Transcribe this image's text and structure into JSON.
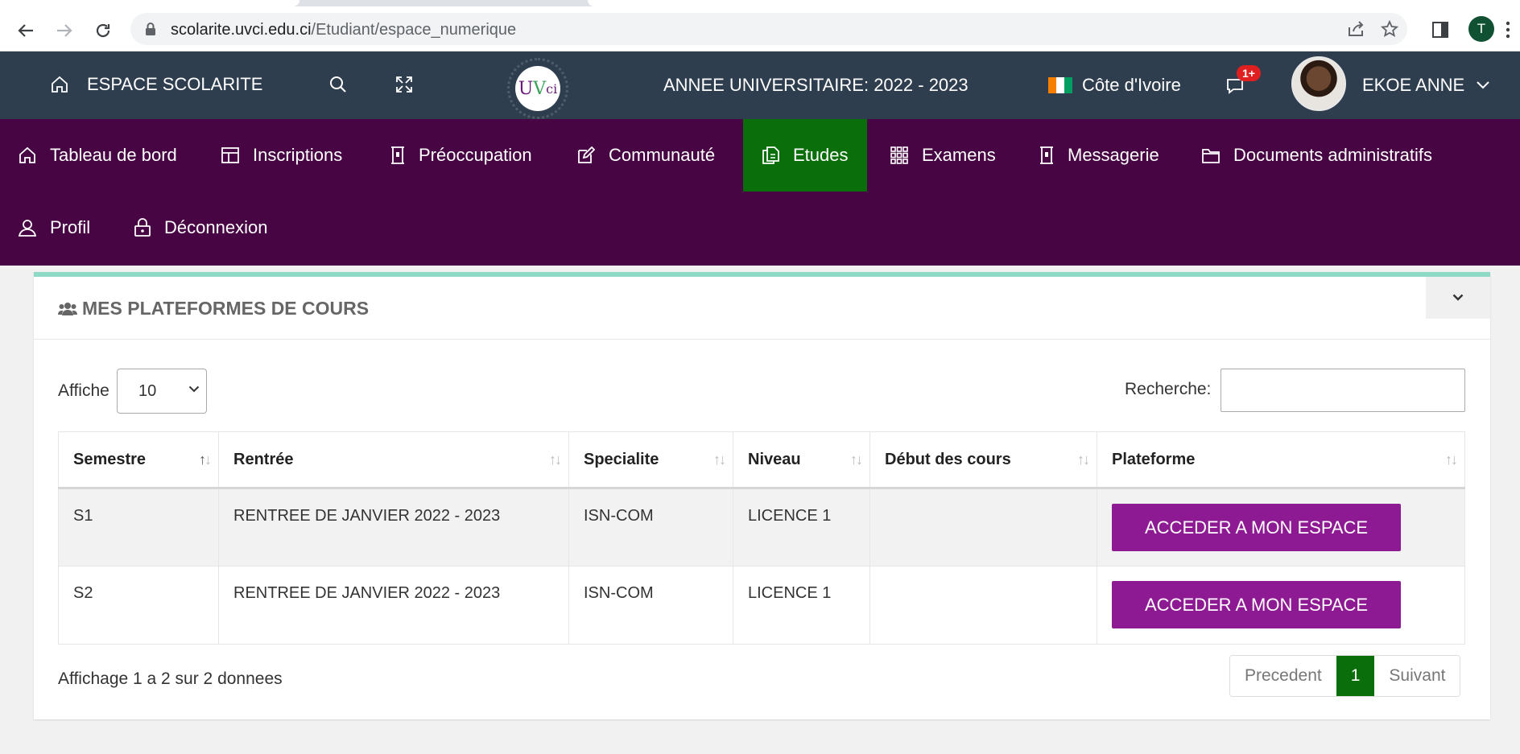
{
  "browser": {
    "url_host": "scolarite.uvci.edu.ci",
    "url_path": "/Etudiant/espace_numerique",
    "profile_initial": "T"
  },
  "topbar": {
    "app_title": "ESPACE SCOLARITE",
    "logo_text_a": "U",
    "logo_text_b": "V",
    "logo_text_c": "ci",
    "academic_year": "ANNEE UNIVERSITAIRE: 2022 - 2023",
    "country": "Côte d'Ivoire",
    "notification_badge": "1+",
    "user_name": "EKOE ANNE"
  },
  "nav": {
    "items": [
      {
        "label": "Tableau de bord",
        "icon": "home-icon"
      },
      {
        "label": "Inscriptions",
        "icon": "layout-icon"
      },
      {
        "label": "Préoccupation",
        "icon": "building-icon"
      },
      {
        "label": "Communauté",
        "icon": "edit-icon"
      },
      {
        "label": "Etudes",
        "icon": "documents-icon",
        "active": true
      },
      {
        "label": "Examens",
        "icon": "grid-icon"
      },
      {
        "label": "Messagerie",
        "icon": "building-icon"
      },
      {
        "label": "Documents administratifs",
        "icon": "folder-icon"
      },
      {
        "label": "Profil",
        "icon": "user-icon"
      },
      {
        "label": "Déconnexion",
        "icon": "lock-icon"
      }
    ]
  },
  "card": {
    "title": "MES PLATEFORMES DE COURS",
    "length_label": "Affiche",
    "length_value": "10",
    "search_label": "Recherche:",
    "search_value": "",
    "columns": [
      "Semestre",
      "Rentrée",
      "Specialite",
      "Niveau",
      "Début des cours",
      "Plateforme"
    ],
    "rows": [
      {
        "semestre": "S1",
        "rentree": "RENTREE DE JANVIER 2022 - 2023",
        "specialite": "ISN-COM",
        "niveau": "LICENCE 1",
        "debut": "",
        "button": "ACCEDER A MON ESPACE"
      },
      {
        "semestre": "S2",
        "rentree": "RENTREE DE JANVIER 2022 - 2023",
        "specialite": "ISN-COM",
        "niveau": "LICENCE 1",
        "debut": "",
        "button": "ACCEDER A MON ESPACE"
      }
    ],
    "info": "Affichage 1 a 2 sur 2 donnees",
    "pager": {
      "prev": "Precedent",
      "current": "1",
      "next": "Suivant"
    }
  },
  "colors": {
    "topbar": "#2f3e4e",
    "nav": "#470544",
    "active": "#0a6f0a",
    "button": "#8e1a93",
    "card_accent": "#8fdac6"
  }
}
